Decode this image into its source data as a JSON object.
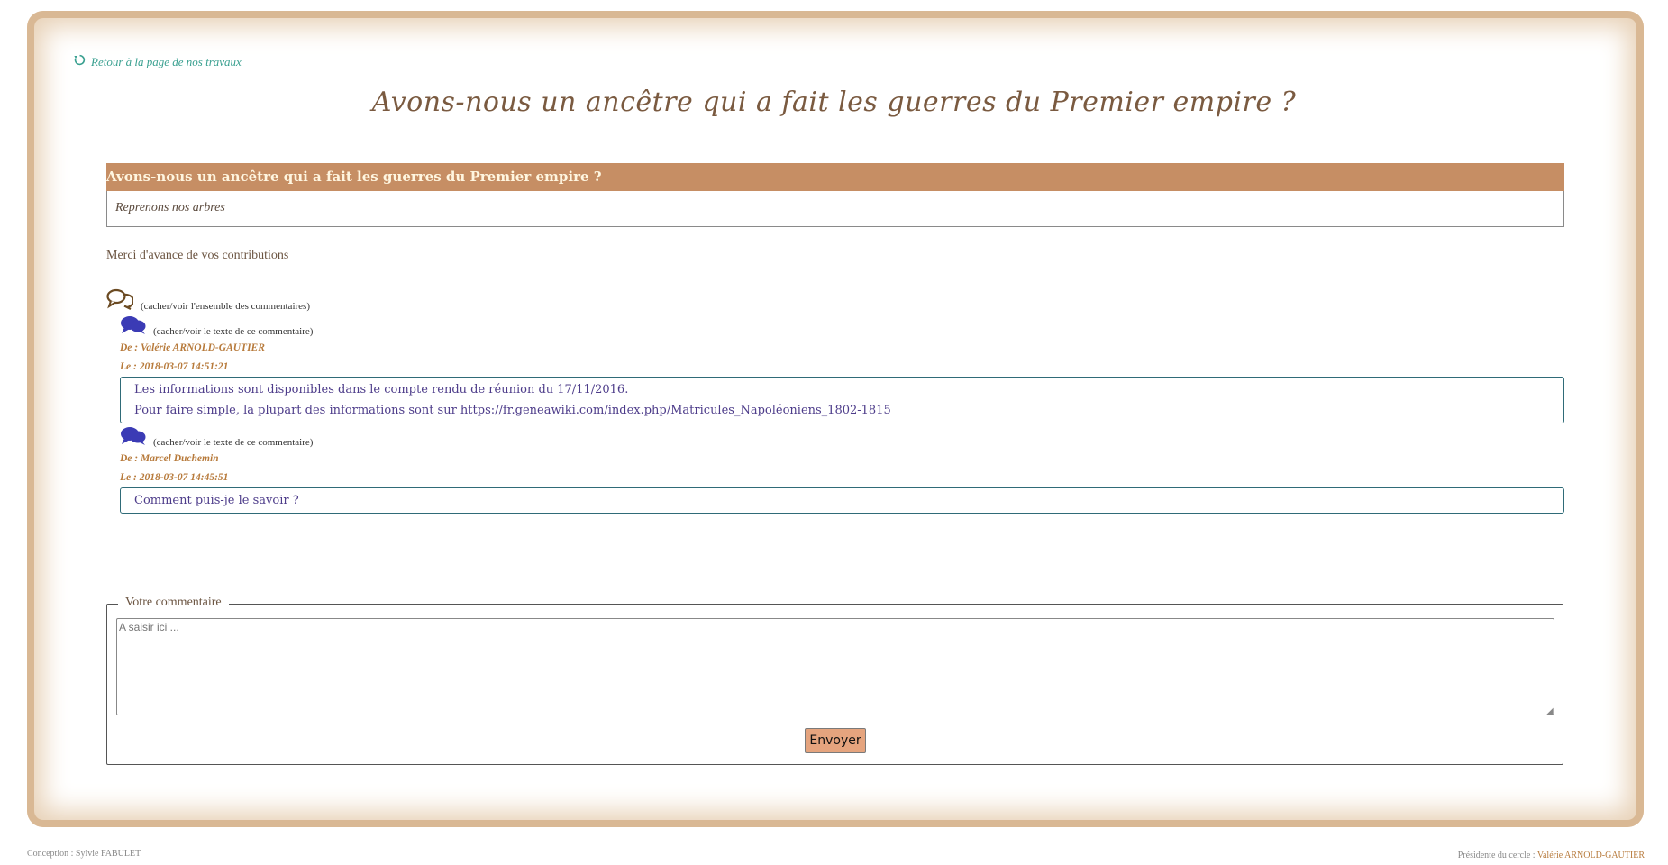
{
  "back_link": {
    "label": "Retour à la page de nos travaux",
    "icon": "refresh-icon"
  },
  "page_title": "Avons-nous un ancêtre qui a fait les guerres du Premier empire ?",
  "article": {
    "title": "Avons-nous un ancêtre qui a fait les guerres du Premier empire ?",
    "subtitle": "Reprenons nos arbres"
  },
  "thanks_text": "Merci d'avance de vos contributions",
  "comments_section": {
    "toggle_all_label": "(cacher/voir l'ensemble des commentaires)",
    "toggle_all_icon": "comments-outline-icon",
    "toggle_one_label": "(cacher/voir le texte de ce commentaire)",
    "comments": [
      {
        "author": "De : Valérie ARNOLD-GAUTIER",
        "date": "Le : 2018-03-07 14:51:21",
        "lines": [
          "Les informations sont disponibles dans le compte rendu de réunion du 17/11/2016.",
          "Pour faire simple, la plupart des informations sont sur https://fr.geneawiki.com/index.php/Matricules_Napoléoniens_1802-1815"
        ]
      },
      {
        "author": "De : Marcel Duchemin",
        "date": "Le : 2018-03-07 14:45:51",
        "lines": [
          "Comment puis-je le savoir ?"
        ]
      }
    ]
  },
  "comment_form": {
    "legend": "Votre commentaire",
    "placeholder": "A saisir ici ...",
    "value": "",
    "submit_label": "Envoyer"
  },
  "footer": {
    "left": "Conception : Sylvie FABULET",
    "right_prefix": "Présidente du cercle : ",
    "right_name": "Valérie ARNOLD-GAUTIER"
  },
  "colors": {
    "header_bg": "#c68e64",
    "accent_teal": "#3aa090",
    "comment_text": "#4d3c8a",
    "meta": "#b77a3b",
    "button_bg": "#e5a47e"
  }
}
